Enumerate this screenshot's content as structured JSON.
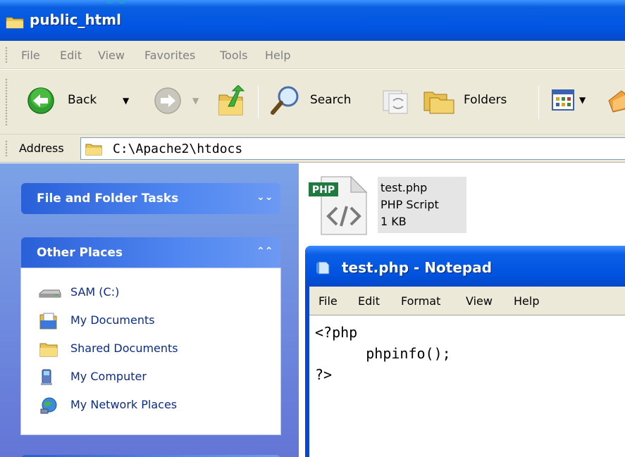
{
  "window": {
    "title": "public_html",
    "cutoff_text": "p                              p"
  },
  "menu": [
    "File",
    "Edit",
    "View",
    "Favorites",
    "Tools",
    "Help"
  ],
  "toolbar": {
    "back_label": "Back",
    "search_label": "Search",
    "folders_label": "Folders"
  },
  "address": {
    "label": "Address",
    "value": "C:\\Apache2\\htdocs"
  },
  "tasks_pane": {
    "header": "File and Folder Tasks",
    "chevron": "»"
  },
  "other_places": {
    "header": "Other Places",
    "chevron": "«",
    "items": [
      {
        "label": "SAM (C:)",
        "icon": "drive-icon"
      },
      {
        "label": "My Documents",
        "icon": "my-documents-icon"
      },
      {
        "label": "Shared Documents",
        "icon": "folder-icon"
      },
      {
        "label": "My Computer",
        "icon": "computer-icon"
      },
      {
        "label": "My Network Places",
        "icon": "network-places-icon"
      }
    ]
  },
  "file": {
    "badge": "PHP",
    "name": "test.php",
    "type": "PHP Script",
    "size": "1 KB"
  },
  "notepad": {
    "title": "test.php - Notepad",
    "menu": [
      "File",
      "Edit",
      "Format",
      "View",
      "Help"
    ],
    "lines": [
      "<?php",
      "      phpinfo();",
      "?>"
    ]
  },
  "colors": {
    "xp_title_blue": "#0054e3",
    "chrome_beige": "#ece9d8",
    "task_pane_blue": "#6375d6",
    "link_blue": "#0c2c8a"
  }
}
